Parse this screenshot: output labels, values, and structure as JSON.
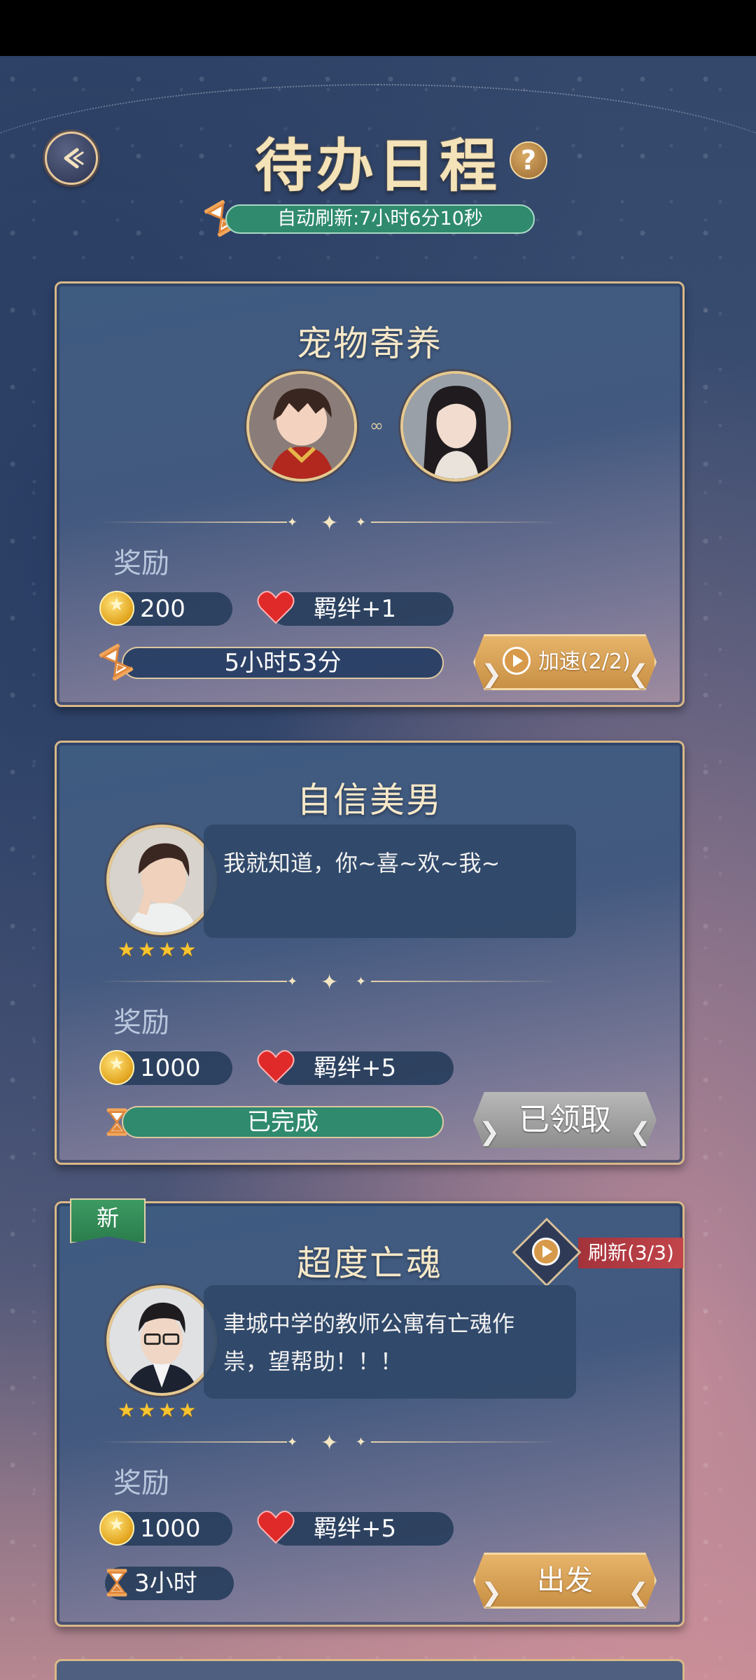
{
  "header": {
    "title": "待办日程",
    "help": "?",
    "auto_refresh": "自动刷新:7小时6分10秒"
  },
  "reward_label": "奖励",
  "cards": [
    {
      "title": "宠物寄养",
      "coins": "200",
      "bond": "羁绊+1",
      "timer": "5小时53分",
      "action": "加速(2/2)"
    },
    {
      "title": "自信美男",
      "message": "我就知道，你~喜~欢~我~",
      "stars": "★★★★",
      "coins": "1000",
      "bond": "羁绊+5",
      "timer": "已完成",
      "action": "已领取"
    },
    {
      "title": "超度亡魂",
      "tag": "新",
      "refresh": "刷新(3/3)",
      "message": "聿城中学的教师公寓有亡魂作祟，望帮助！！！",
      "stars": "★★★★",
      "coins": "1000",
      "bond": "羁绊+5",
      "timer": "3小时",
      "action": "出发"
    }
  ],
  "colors": {
    "gold": "#d9b887",
    "green_bar": "#2f8a6e",
    "accent_red": "#c2454b"
  }
}
